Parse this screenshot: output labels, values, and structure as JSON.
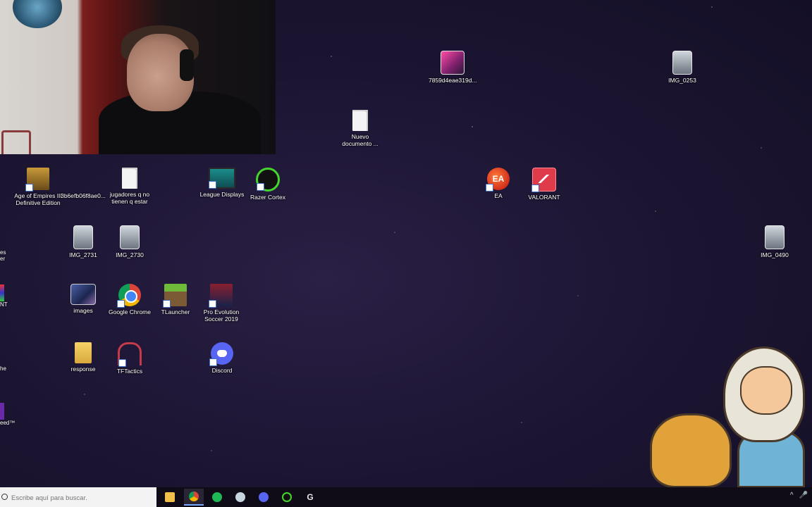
{
  "desktop": {
    "icons": [
      {
        "label": "7859d4eae319d...",
        "kind": "pink"
      },
      {
        "label": "IMG_0253",
        "kind": "photo"
      },
      {
        "label": "Nuevo documento ...",
        "kind": "doc"
      },
      {
        "label": "Age of Empires III Definitive Edition",
        "kind": "aoe"
      },
      {
        "label": "3b6efb06f8ae0...",
        "kind": "none"
      },
      {
        "label": "jugadores q no tienen q estar",
        "kind": "doc"
      },
      {
        "label": "League Displays",
        "kind": "league"
      },
      {
        "label": "Razer Cortex",
        "kind": "razer"
      },
      {
        "label": "EA",
        "kind": "ea"
      },
      {
        "label": "VALORANT",
        "kind": "valorant"
      },
      {
        "label": "IMG_2731",
        "kind": "photo"
      },
      {
        "label": "IMG_2730",
        "kind": "photo"
      },
      {
        "label": "IMG_0490",
        "kind": "photo"
      },
      {
        "label": "images",
        "kind": "images"
      },
      {
        "label": "Google Chrome",
        "kind": "chrome"
      },
      {
        "label": "TLauncher",
        "kind": "tlauncher"
      },
      {
        "label": "Pro Evolution Soccer 2019",
        "kind": "pes"
      },
      {
        "label": "response",
        "kind": "folder"
      },
      {
        "label": "TFTactics",
        "kind": "tft"
      },
      {
        "label": "Discord",
        "kind": "discord"
      }
    ],
    "cut_labels": [
      "es",
      "er",
      "NT",
      "he",
      "eed™"
    ]
  },
  "taskbar": {
    "search_placeholder": "Escribe aquí para buscar.",
    "apps": [
      {
        "name": "file-explorer",
        "color": "#f0c04a"
      },
      {
        "name": "google-chrome",
        "color": "#db4437"
      },
      {
        "name": "spotify",
        "color": "#1db954"
      },
      {
        "name": "steam",
        "color": "#c7d5e0"
      },
      {
        "name": "discord",
        "color": "#5865f2"
      },
      {
        "name": "razer-cortex",
        "color": "#44d62c"
      },
      {
        "name": "g-hub",
        "color": "#e6e6e6"
      }
    ],
    "tray": [
      "^",
      "🎤"
    ]
  },
  "colors": {
    "wallpaper": "#1d1634",
    "taskbar": "#0f0c17"
  }
}
